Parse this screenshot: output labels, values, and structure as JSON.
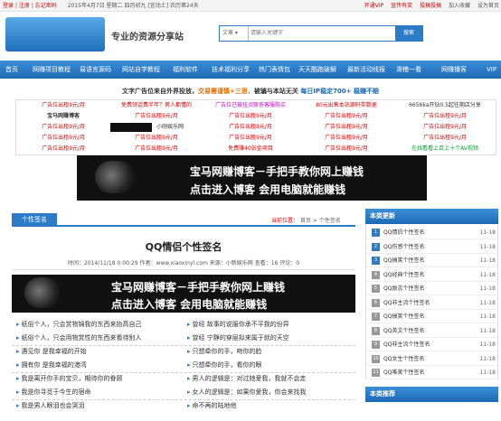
{
  "topbar": {
    "login": "登录",
    "register": "注册",
    "forgot": "忘记密码",
    "date": "2015年4月7日 星期二 四月初九",
    "luck": "[宜动土]",
    "day_of_year": "农历第24天",
    "links": [
      "开通VIP",
      "宣传有奖",
      "投稿投搞",
      "加入收藏",
      "设为首页"
    ]
  },
  "header": {
    "slogan": "专业的资源分享站",
    "search_category": "文章",
    "search_placeholder": "请输入关键字",
    "search_button": "搜索"
  },
  "nav": {
    "items": [
      "首页",
      "网赚项目教程",
      "易语言源码",
      "网站自学教程",
      "福利软件",
      "技术福利分享",
      "热门表情包",
      "天天酷跑破解",
      "最新活动线报",
      "滑稽一看",
      "网赚播客",
      "VIP"
    ]
  },
  "adline": {
    "prefix": "文字广告位来自外界投放，",
    "orange": "交易需谨慎+三思，",
    "suffix": "被骗与本站无关",
    "blue": "每日IP稳定700+ 稳赚不赔"
  },
  "ads": {
    "rows": [
      [
        "广告位出租9元/月",
        "免费领话费半年？男人都懂的",
        "广告位已被挂点联系客服购买",
        "80元出售本站源码带数据",
        "6656ka开钻0.5起往期店分享"
      ],
      [
        "宝马网赚博客",
        "广告位出租9元/月",
        "广告位出租9元/月",
        "广告位出租9元/月",
        "广告位出租9元/月"
      ],
      [
        "广告位出租9元/月",
        "小刚娱乐网",
        "广告位出租9元/月",
        "广告位出租9元/月",
        "广告位出租9元/月"
      ],
      [
        "广告位出租9元/月",
        "广告位出租9元/月",
        "广告位出租9元/月",
        "广告位出租9元/月",
        "广告位出租9元/月"
      ],
      [
        "广告位出租9元/月",
        "广告位出租9元/月",
        "免费赚40张金项目",
        "广告位出租9元/月",
        "在线看看上百上十个AV视频"
      ]
    ],
    "colors": [
      "#d00",
      "#333",
      "#c0c",
      "#d00",
      "#333"
    ]
  },
  "banner": {
    "line1": "宝马网赚博客－手把手教你网上赚钱",
    "line2": "点击进入博客    会用电脑就能赚钱"
  },
  "article": {
    "tab": "个性签名",
    "crumb_prefix": "当前位置：",
    "crumb_home": "首页",
    "crumb_sep": ">",
    "crumb_section": "个性签名",
    "title": "QQ情侣个性签名",
    "meta": "时间：2014/11/18 0:00:29  作者：www.xiaoxinyl.com  来源：小新娱乐网  查看：16  评论：0",
    "signatures": [
      [
        "纸俗个人，只会赏物锦我的东西来抬高自己",
        "曾经 故事的说服你承不平我的份异"
      ],
      [
        "纸俗个人，只会用物赏性的东西来看待别人",
        "曾经 宁静的穿层拟来属于就的天空"
      ],
      [
        "遇见你 是我幸福的开始",
        "只想牵你的手，吻你的脸"
      ],
      [
        "拥有你 是我幸福的港湾",
        "只想牵你的手，看你的眼"
      ],
      [
        "我是离开你手的宝贝，期待你的眷顾",
        "男人的逻辑是：对过她爱我，我就不会走"
      ],
      [
        "我是你寻觅于今生的宿命",
        "女人的逻辑是：如果你爱我，你会来找我"
      ],
      [
        "我是男人眼泪也会哭泪",
        "命不再的陆地他"
      ]
    ]
  },
  "sidebar": {
    "title1": "本类更新",
    "title2": "本类推荐",
    "items": [
      {
        "num": "1",
        "title": "QQ情侣个性签名",
        "date": "11-18"
      },
      {
        "num": "2",
        "title": "QQ伤感个性签名",
        "date": "11-18"
      },
      {
        "num": "3",
        "title": "QQ搞笑个性签名",
        "date": "11-18"
      },
      {
        "num": "4",
        "title": "QQ经典个性签名",
        "date": "11-18"
      },
      {
        "num": "5",
        "title": "QQ励志个性签名",
        "date": "11-18"
      },
      {
        "num": "6",
        "title": "QQ非主流个性签名",
        "date": "11-18"
      },
      {
        "num": "7",
        "title": "QQ搞笑个性签名",
        "date": "11-18"
      },
      {
        "num": "8",
        "title": "QQ英文个性签名",
        "date": "11-18"
      },
      {
        "num": "9",
        "title": "QQ非主流个性签名",
        "date": "11-18"
      },
      {
        "num": "10",
        "title": "QQ女生个性签名",
        "date": "11-18"
      },
      {
        "num": "11",
        "title": "QQ唯美个性签名",
        "date": "11-18"
      }
    ]
  }
}
